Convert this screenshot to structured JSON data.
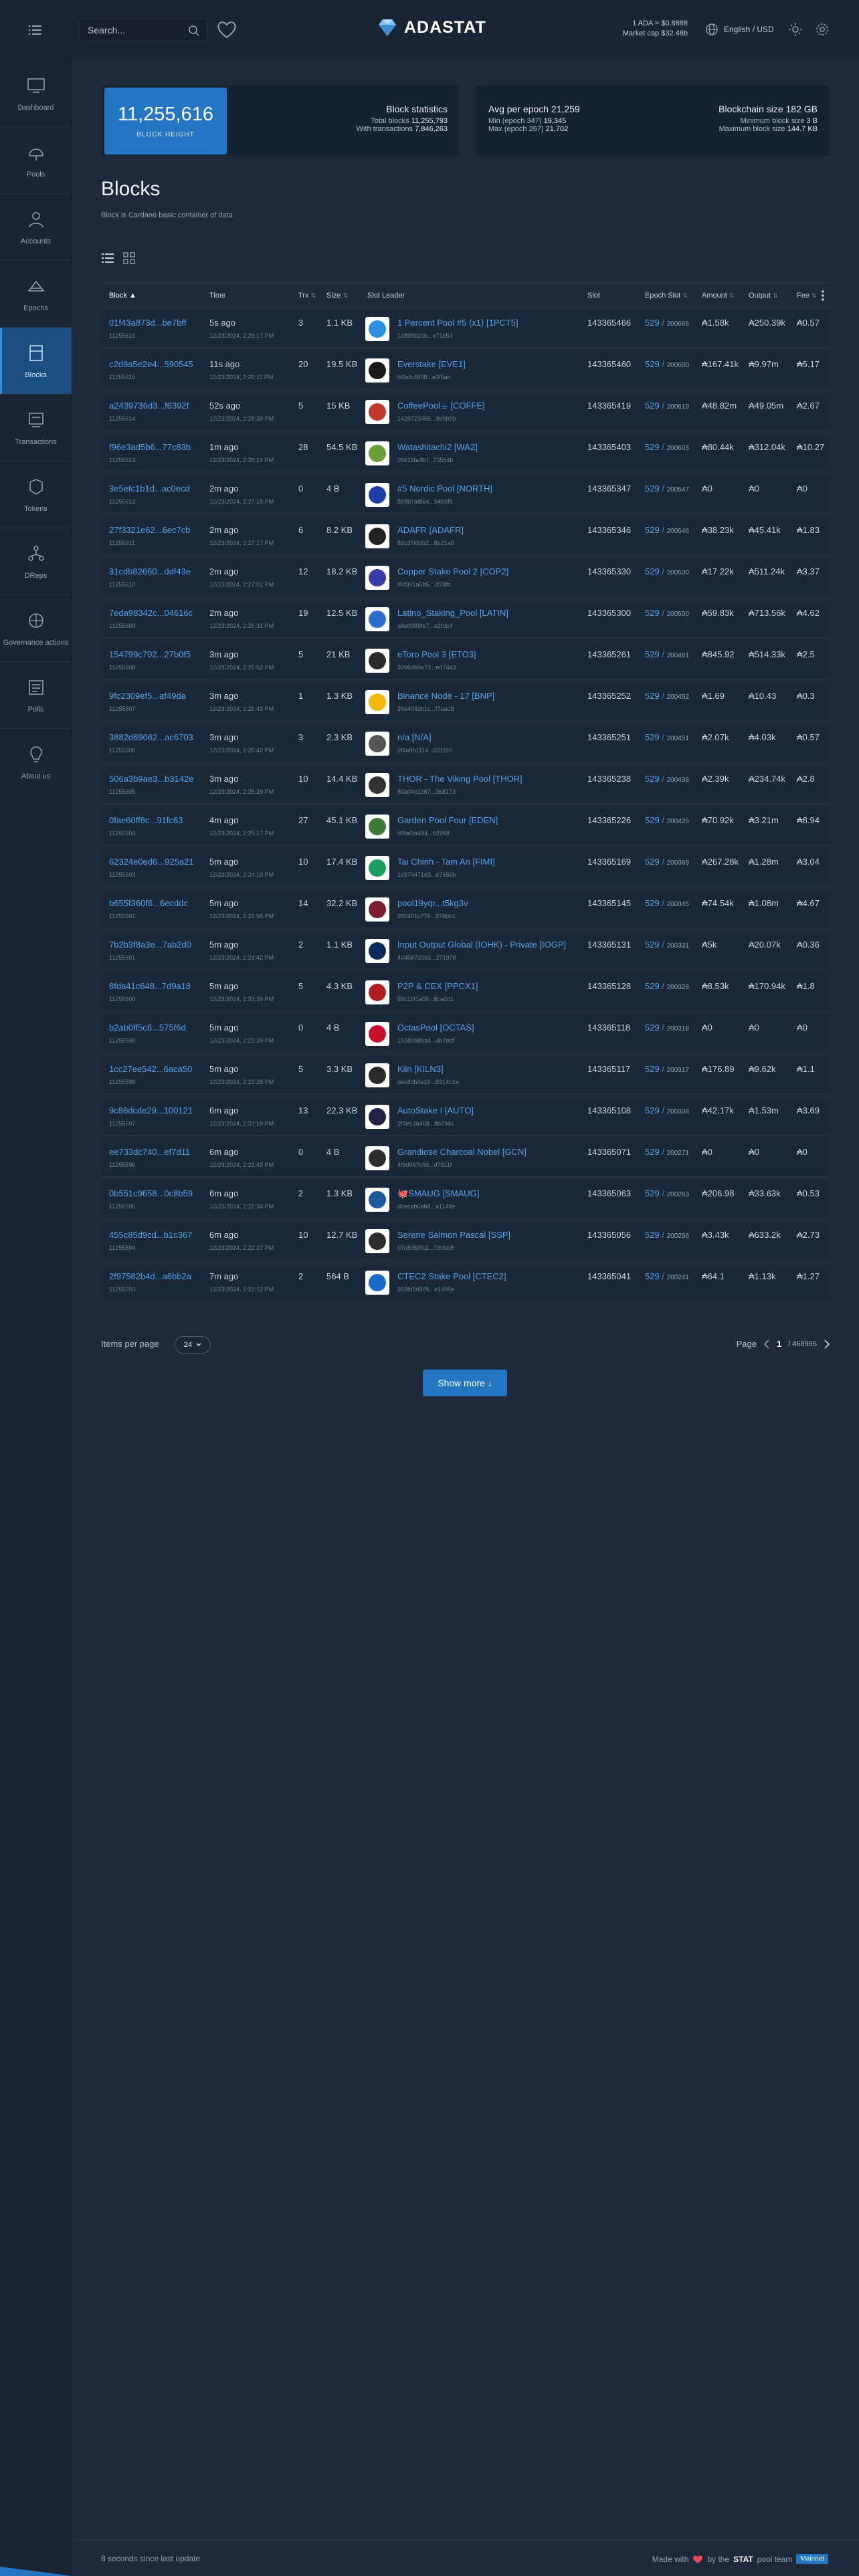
{
  "header": {
    "search_placeholder": "Search...",
    "logo_text": "ADASTAT",
    "price_line": "1 ADA = $0.8888",
    "market_cap": "Market cap $32.48b",
    "language": "English / USD"
  },
  "sidebar": {
    "items": [
      {
        "label": "Dashboard",
        "icon": "dashboard-icon"
      },
      {
        "label": "Pools",
        "icon": "pools-icon"
      },
      {
        "label": "Accounts",
        "icon": "accounts-icon"
      },
      {
        "label": "Epochs",
        "icon": "epochs-icon"
      },
      {
        "label": "Blocks",
        "icon": "blocks-icon",
        "active": true
      },
      {
        "label": "Transactions",
        "icon": "transactions-icon"
      },
      {
        "label": "Tokens",
        "icon": "tokens-icon"
      },
      {
        "label": "DReps",
        "icon": "dreps-icon"
      },
      {
        "label": "Governance actions",
        "icon": "governance-icon"
      },
      {
        "label": "Polls",
        "icon": "polls-icon"
      },
      {
        "label": "About us",
        "icon": "about-icon"
      }
    ]
  },
  "stats": {
    "block_height": "11,255,616",
    "block_height_label": "BLOCK HEIGHT",
    "block_stats_title": "Block statistics",
    "total_blocks_label": "Total blocks",
    "total_blocks": "11,255,793",
    "with_tx_label": "With transactions",
    "with_tx": "7,846,263",
    "avg_per_epoch_label": "Avg per epoch",
    "avg_per_epoch": "21,259",
    "min_label": "Min (epoch 347)",
    "min_value": "19,345",
    "max_label": "Max (epoch 267)",
    "max_value": "21,702",
    "chain_size_label": "Blockchain size",
    "chain_size": "182 GB",
    "min_block_label": "Minimum block size",
    "min_block": "3 B",
    "max_block_label": "Maximum block size",
    "max_block": "144.7 KB"
  },
  "page": {
    "title": "Blocks",
    "subtitle": "Block is Cardano basic container of data"
  },
  "table": {
    "headers": {
      "block": "Block ▲",
      "time": "Time",
      "trx": "Trx",
      "size": "Size",
      "slot_leader": "Slot Leader",
      "slot": "Slot",
      "epoch_slot": "Epoch Slot",
      "amount": "Amount",
      "output": "Output",
      "fee": "Fee"
    },
    "sort_mark": "⇅",
    "rows": [
      {
        "hash": "01f43a873d...be7bff",
        "height": "11255616",
        "ago": "5s ago",
        "date": "12/23/2024, 2:29:17 PM",
        "trx": "3",
        "size": "1.1 KB",
        "pool": "1 Percent Pool #5 (x1) [1PCT5]",
        "pool_id": "1d898b20b...e71b53",
        "avatar": "#2e8fe0",
        "slot": "143365466",
        "epoch": "529",
        "eslot": "200666",
        "amount": "₳1.58k",
        "output": "₳250.39k",
        "fee": "₳0.57"
      },
      {
        "hash": "c2d9a5e2e4...590545",
        "height": "11255615",
        "ago": "11s ago",
        "date": "12/23/2024, 2:29:11 PM",
        "trx": "20",
        "size": "19.5 KB",
        "pool": "Everstake [EVE1]",
        "pool_id": "b4bdc4808...e3f5ab",
        "avatar": "#1a1a1a",
        "slot": "143365460",
        "epoch": "529",
        "eslot": "200660",
        "amount": "₳167.41k",
        "output": "₳9.97m",
        "fee": "₳5.17"
      },
      {
        "hash": "a2439736d3...f6392f",
        "height": "11255614",
        "ago": "52s ago",
        "date": "12/23/2024, 2:28:30 PM",
        "trx": "5",
        "size": "15 KB",
        "pool": "CoffeePool☕ [COFFE]",
        "pool_id": "1428723466...9e5b9b",
        "avatar": "#c0392b",
        "slot": "143365419",
        "epoch": "529",
        "eslot": "200619",
        "amount": "₳48.82m",
        "output": "₳49.05m",
        "fee": "₳2.67"
      },
      {
        "hash": "f96e3ad5b6...77c83b",
        "height": "11255613",
        "ago": "1m ago",
        "date": "12/23/2024, 2:28:14 PM",
        "trx": "28",
        "size": "54.5 KB",
        "pool": "Watashitachi2 [WA2]",
        "pool_id": "09611bc8cf...73554b",
        "avatar": "#6a9f3a",
        "slot": "143365403",
        "epoch": "529",
        "eslot": "200603",
        "amount": "₳80.44k",
        "output": "₳312.04k",
        "fee": "₳10.27"
      },
      {
        "hash": "3e5efc1b1d...ac0ecd",
        "height": "11255612",
        "ago": "2m ago",
        "date": "12/23/2024, 2:27:18 PM",
        "trx": "0",
        "size": "4 B",
        "pool": "#5 Nordic Pool [NORTH]",
        "pool_id": "898b7a8fe4...94b5f8",
        "avatar": "#1f3fa8",
        "slot": "143365347",
        "epoch": "529",
        "eslot": "200547",
        "amount": "₳0",
        "output": "₳0",
        "fee": "₳0"
      },
      {
        "hash": "27f3321e62...6ec7cb",
        "height": "11255611",
        "ago": "2m ago",
        "date": "12/23/2024, 2:27:17 PM",
        "trx": "6",
        "size": "8.2 KB",
        "pool": "ADAFR [ADAFR]",
        "pool_id": "82c3f90db2...8e21a8",
        "avatar": "#222222",
        "slot": "143365346",
        "epoch": "529",
        "eslot": "200546",
        "amount": "₳38.23k",
        "output": "₳45.41k",
        "fee": "₳1.83"
      },
      {
        "hash": "31cdb82660...ddf43e",
        "height": "11255610",
        "ago": "2m ago",
        "date": "12/23/2024, 2:27:01 PM",
        "trx": "12",
        "size": "18.2 KB",
        "pool": "Copper Stake Pool 2 [COP2]",
        "pool_id": "80f301a5b5...2f74fc",
        "avatar": "#3a3aa8",
        "slot": "143365330",
        "epoch": "529",
        "eslot": "200530",
        "amount": "₳17.22k",
        "output": "₳511.24k",
        "fee": "₳3.37"
      },
      {
        "hash": "7eda98342c...04616c",
        "height": "11255609",
        "ago": "2m ago",
        "date": "12/23/2024, 2:26:31 PM",
        "trx": "19",
        "size": "12.5 KB",
        "pool": "Latino_Staking_Pool [LATIN]",
        "pool_id": "a8e0999fe7...e2fdc4",
        "avatar": "#2a6ed0",
        "slot": "143365300",
        "epoch": "529",
        "eslot": "200500",
        "amount": "₳59.83k",
        "output": "₳713.56k",
        "fee": "₳4.62"
      },
      {
        "hash": "154799c702...27b0f5",
        "height": "11255608",
        "ago": "3m ago",
        "date": "12/23/2024, 2:25:52 PM",
        "trx": "5",
        "size": "21 KB",
        "pool": "eToro Pool 3 [ETO3]",
        "pool_id": "3096d60e73...ed7443",
        "avatar": "#2a2a2a",
        "slot": "143365261",
        "epoch": "529",
        "eslot": "200461",
        "amount": "₳845.92",
        "output": "₳514.33k",
        "fee": "₳2.5"
      },
      {
        "hash": "9fc2309ef5...af49da",
        "height": "11255607",
        "ago": "3m ago",
        "date": "12/23/2024, 2:25:43 PM",
        "trx": "1",
        "size": "1.3 KB",
        "pool": "Binance Node - 17 [BNP]",
        "pool_id": "39e4092b1c...f7ead8",
        "avatar": "#f0b90b",
        "slot": "143365252",
        "epoch": "529",
        "eslot": "200452",
        "amount": "₳1.69",
        "output": "₳10.43",
        "fee": "₳0.3"
      },
      {
        "hash": "3882d69062...ac6703",
        "height": "11255606",
        "ago": "3m ago",
        "date": "12/23/2024, 2:25:42 PM",
        "trx": "3",
        "size": "2.3 KB",
        "pool": "n/a [N/A]",
        "pool_id": "2f4a9b1114...601f20",
        "avatar": "#555555",
        "slot": "143365251",
        "epoch": "529",
        "eslot": "200451",
        "amount": "₳2.07k",
        "output": "₳4.03k",
        "fee": "₳0.57"
      },
      {
        "hash": "506a3b9ae3...b3142e",
        "height": "11255605",
        "ago": "3m ago",
        "date": "12/23/2024, 2:25:29 PM",
        "trx": "10",
        "size": "14.4 KB",
        "pool": "THOR - The Viking Pool [THOR]",
        "pool_id": "80a04c1367...368173",
        "avatar": "#333333",
        "slot": "143365238",
        "epoch": "529",
        "eslot": "200438",
        "amount": "₳2.39k",
        "output": "₳234.74k",
        "fee": "₳2.8"
      },
      {
        "hash": "0fae60ff8c...91fc63",
        "height": "11255604",
        "ago": "4m ago",
        "date": "12/23/2024, 2:25:17 PM",
        "trx": "27",
        "size": "45.1 KB",
        "pool": "Garden Pool Four [EDEN]",
        "pool_id": "d9fa6fa484...b29f0f",
        "avatar": "#3d7a3a",
        "slot": "143365226",
        "epoch": "529",
        "eslot": "200426",
        "amount": "₳70.92k",
        "output": "₳3.21m",
        "fee": "₳8.94"
      },
      {
        "hash": "62324e0ed6...925a21",
        "height": "11255603",
        "ago": "5m ago",
        "date": "12/23/2024, 2:24:10 PM",
        "trx": "10",
        "size": "17.4 KB",
        "pool": "Tai Chinh - Tam An [FIMI]",
        "pool_id": "1e574471d3...e7659b",
        "avatar": "#1a9e5e",
        "slot": "143365169",
        "epoch": "529",
        "eslot": "200369",
        "amount": "₳267.28k",
        "output": "₳1.28m",
        "fee": "₳3.04"
      },
      {
        "hash": "b655f360f6...6ecddc",
        "height": "11255602",
        "ago": "5m ago",
        "date": "12/23/2024, 2:23:56 PM",
        "trx": "14",
        "size": "32.2 KB",
        "pool": "pool19yqr...t5kg3v",
        "pool_id": "280401c779...878bb1",
        "avatar": "#7a1f2f",
        "slot": "143365145",
        "epoch": "529",
        "eslot": "200345",
        "amount": "₳74.54k",
        "output": "₳1.08m",
        "fee": "₳4.67"
      },
      {
        "hash": "7b2b3f8a3e...7ab2d0",
        "height": "11255601",
        "ago": "5m ago",
        "date": "12/23/2024, 2:23:42 PM",
        "trx": "2",
        "size": "1.1 KB",
        "pool": "Input Output Global (IOHK) - Private [IOGP]",
        "pool_id": "4045872033...271978",
        "avatar": "#0a2a5a",
        "slot": "143365131",
        "epoch": "529",
        "eslot": "200331",
        "amount": "₳5k",
        "output": "₳20.07k",
        "fee": "₳0.36"
      },
      {
        "hash": "8fda41c648...7d9a18",
        "height": "11255600",
        "ago": "5m ago",
        "date": "12/23/2024, 2:23:39 PM",
        "trx": "5",
        "size": "4.3 KB",
        "pool": "P2P & CEX [PPCX1]",
        "pool_id": "93c1bf1a56...8ca2d1",
        "avatar": "#b02020",
        "slot": "143365128",
        "epoch": "529",
        "eslot": "200328",
        "amount": "₳8.53k",
        "output": "₳170.94k",
        "fee": "₳1.8"
      },
      {
        "hash": "b2ab0ff5c6...575f6d",
        "height": "11255599",
        "ago": "5m ago",
        "date": "12/23/2024, 2:23:29 PM",
        "trx": "0",
        "size": "4 B",
        "pool": "OctasPool [OCTAS]",
        "pool_id": "15380b8ba4...4b7edf",
        "avatar": "#c8102e",
        "slot": "143365118",
        "epoch": "529",
        "eslot": "200318",
        "amount": "₳0",
        "output": "₳0",
        "fee": "₳0"
      },
      {
        "hash": "1cc27ee542...6aca50",
        "height": "11255598",
        "ago": "5m ago",
        "date": "12/23/2024, 2:23:28 PM",
        "trx": "5",
        "size": "3.3 KB",
        "pool": "Kiln [KILN3]",
        "pool_id": "dec8db3e16...8314c1e",
        "avatar": "#2a2a2a",
        "slot": "143365117",
        "epoch": "529",
        "eslot": "200317",
        "amount": "₳176.89",
        "output": "₳9.62k",
        "fee": "₳1.1"
      },
      {
        "hash": "9c86dcde29...100121",
        "height": "11255597",
        "ago": "6m ago",
        "date": "12/23/2024, 2:23:19 PM",
        "trx": "13",
        "size": "22.3 KB",
        "pool": "AutoStake I [AUTO]",
        "pool_id": "2f3e63a468...8b794c",
        "avatar": "#222244",
        "slot": "143365108",
        "epoch": "529",
        "eslot": "200308",
        "amount": "₳42.17k",
        "output": "₳1.53m",
        "fee": "₳3.69"
      },
      {
        "hash": "ee733dc740...ef7d11",
        "height": "11255596",
        "ago": "6m ago",
        "date": "12/23/2024, 2:22:42 PM",
        "trx": "0",
        "size": "4 B",
        "pool": "Grandiose Charcoal Nobel [GCN]",
        "pool_id": "4f9d967c0d...d7811f",
        "avatar": "#2d2d2d",
        "slot": "143365071",
        "epoch": "529",
        "eslot": "200271",
        "amount": "₳0",
        "output": "₳0",
        "fee": "₳0"
      },
      {
        "hash": "0b551c9658...0c8b59",
        "height": "11255595",
        "ago": "6m ago",
        "date": "12/23/2024, 2:22:34 PM",
        "trx": "2",
        "size": "1.3 KB",
        "pool": "🐙SMAUG [SMAUG]",
        "pool_id": "dbecab6ab8...a1148e",
        "avatar": "#1e5aa0",
        "slot": "143365063",
        "epoch": "529",
        "eslot": "200263",
        "amount": "₳206.98",
        "output": "₳33.63k",
        "fee": "₳0.53"
      },
      {
        "hash": "455c85d9cd...b1c367",
        "height": "11255594",
        "ago": "6m ago",
        "date": "12/23/2024, 2:22:27 PM",
        "trx": "10",
        "size": "12.7 KB",
        "pool": "Serene Salmon Pascal [SSP]",
        "pool_id": "07c8053fc3...730bb8",
        "avatar": "#2d2d2d",
        "slot": "143365056",
        "epoch": "529",
        "eslot": "200256",
        "amount": "₳3.43k",
        "output": "₳633.2k",
        "fee": "₳2.73"
      },
      {
        "hash": "2f97582b4d...a6bb2a",
        "height": "11255593",
        "ago": "7m ago",
        "date": "12/23/2024, 2:22:12 PM",
        "trx": "2",
        "size": "564 B",
        "pool": "CTEC2 Stake Pool [CTEC2]",
        "pool_id": "959fd2d305...e1495e",
        "avatar": "#1a6acc",
        "slot": "143365041",
        "epoch": "529",
        "eslot": "200241",
        "amount": "₳64.1",
        "output": "₳1.13k",
        "fee": "₳1.27"
      }
    ]
  },
  "pagination": {
    "items_per_page_label": "Items per page",
    "items_per_page": "24",
    "page_label": "Page",
    "current_page": "1",
    "total_pages": "/ 468985"
  },
  "show_more": "Show more ↓",
  "footer": {
    "last_update": "8 seconds since last update",
    "made_with": "Made with",
    "by_the": "by the",
    "stat": "STAT",
    "pool_team": "pool team",
    "team_badge": "Mainnet"
  },
  "colors": {
    "accent": "#2476c2",
    "link": "#4fa3ec",
    "background": "#1e2a3a"
  }
}
